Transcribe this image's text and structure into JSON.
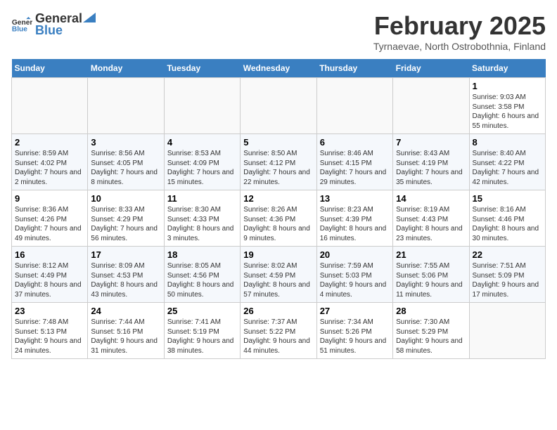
{
  "header": {
    "logo_general": "General",
    "logo_blue": "Blue",
    "title": "February 2025",
    "subtitle": "Tyrnaevae, North Ostrobothnia, Finland"
  },
  "weekdays": [
    "Sunday",
    "Monday",
    "Tuesday",
    "Wednesday",
    "Thursday",
    "Friday",
    "Saturday"
  ],
  "weeks": [
    [
      {
        "day": "",
        "info": ""
      },
      {
        "day": "",
        "info": ""
      },
      {
        "day": "",
        "info": ""
      },
      {
        "day": "",
        "info": ""
      },
      {
        "day": "",
        "info": ""
      },
      {
        "day": "",
        "info": ""
      },
      {
        "day": "1",
        "info": "Sunrise: 9:03 AM\nSunset: 3:58 PM\nDaylight: 6 hours and 55 minutes."
      }
    ],
    [
      {
        "day": "2",
        "info": "Sunrise: 8:59 AM\nSunset: 4:02 PM\nDaylight: 7 hours and 2 minutes."
      },
      {
        "day": "3",
        "info": "Sunrise: 8:56 AM\nSunset: 4:05 PM\nDaylight: 7 hours and 8 minutes."
      },
      {
        "day": "4",
        "info": "Sunrise: 8:53 AM\nSunset: 4:09 PM\nDaylight: 7 hours and 15 minutes."
      },
      {
        "day": "5",
        "info": "Sunrise: 8:50 AM\nSunset: 4:12 PM\nDaylight: 7 hours and 22 minutes."
      },
      {
        "day": "6",
        "info": "Sunrise: 8:46 AM\nSunset: 4:15 PM\nDaylight: 7 hours and 29 minutes."
      },
      {
        "day": "7",
        "info": "Sunrise: 8:43 AM\nSunset: 4:19 PM\nDaylight: 7 hours and 35 minutes."
      },
      {
        "day": "8",
        "info": "Sunrise: 8:40 AM\nSunset: 4:22 PM\nDaylight: 7 hours and 42 minutes."
      }
    ],
    [
      {
        "day": "9",
        "info": "Sunrise: 8:36 AM\nSunset: 4:26 PM\nDaylight: 7 hours and 49 minutes."
      },
      {
        "day": "10",
        "info": "Sunrise: 8:33 AM\nSunset: 4:29 PM\nDaylight: 7 hours and 56 minutes."
      },
      {
        "day": "11",
        "info": "Sunrise: 8:30 AM\nSunset: 4:33 PM\nDaylight: 8 hours and 3 minutes."
      },
      {
        "day": "12",
        "info": "Sunrise: 8:26 AM\nSunset: 4:36 PM\nDaylight: 8 hours and 9 minutes."
      },
      {
        "day": "13",
        "info": "Sunrise: 8:23 AM\nSunset: 4:39 PM\nDaylight: 8 hours and 16 minutes."
      },
      {
        "day": "14",
        "info": "Sunrise: 8:19 AM\nSunset: 4:43 PM\nDaylight: 8 hours and 23 minutes."
      },
      {
        "day": "15",
        "info": "Sunrise: 8:16 AM\nSunset: 4:46 PM\nDaylight: 8 hours and 30 minutes."
      }
    ],
    [
      {
        "day": "16",
        "info": "Sunrise: 8:12 AM\nSunset: 4:49 PM\nDaylight: 8 hours and 37 minutes."
      },
      {
        "day": "17",
        "info": "Sunrise: 8:09 AM\nSunset: 4:53 PM\nDaylight: 8 hours and 43 minutes."
      },
      {
        "day": "18",
        "info": "Sunrise: 8:05 AM\nSunset: 4:56 PM\nDaylight: 8 hours and 50 minutes."
      },
      {
        "day": "19",
        "info": "Sunrise: 8:02 AM\nSunset: 4:59 PM\nDaylight: 8 hours and 57 minutes."
      },
      {
        "day": "20",
        "info": "Sunrise: 7:59 AM\nSunset: 5:03 PM\nDaylight: 9 hours and 4 minutes."
      },
      {
        "day": "21",
        "info": "Sunrise: 7:55 AM\nSunset: 5:06 PM\nDaylight: 9 hours and 11 minutes."
      },
      {
        "day": "22",
        "info": "Sunrise: 7:51 AM\nSunset: 5:09 PM\nDaylight: 9 hours and 17 minutes."
      }
    ],
    [
      {
        "day": "23",
        "info": "Sunrise: 7:48 AM\nSunset: 5:13 PM\nDaylight: 9 hours and 24 minutes."
      },
      {
        "day": "24",
        "info": "Sunrise: 7:44 AM\nSunset: 5:16 PM\nDaylight: 9 hours and 31 minutes."
      },
      {
        "day": "25",
        "info": "Sunrise: 7:41 AM\nSunset: 5:19 PM\nDaylight: 9 hours and 38 minutes."
      },
      {
        "day": "26",
        "info": "Sunrise: 7:37 AM\nSunset: 5:22 PM\nDaylight: 9 hours and 44 minutes."
      },
      {
        "day": "27",
        "info": "Sunrise: 7:34 AM\nSunset: 5:26 PM\nDaylight: 9 hours and 51 minutes."
      },
      {
        "day": "28",
        "info": "Sunrise: 7:30 AM\nSunset: 5:29 PM\nDaylight: 9 hours and 58 minutes."
      },
      {
        "day": "",
        "info": ""
      }
    ]
  ]
}
